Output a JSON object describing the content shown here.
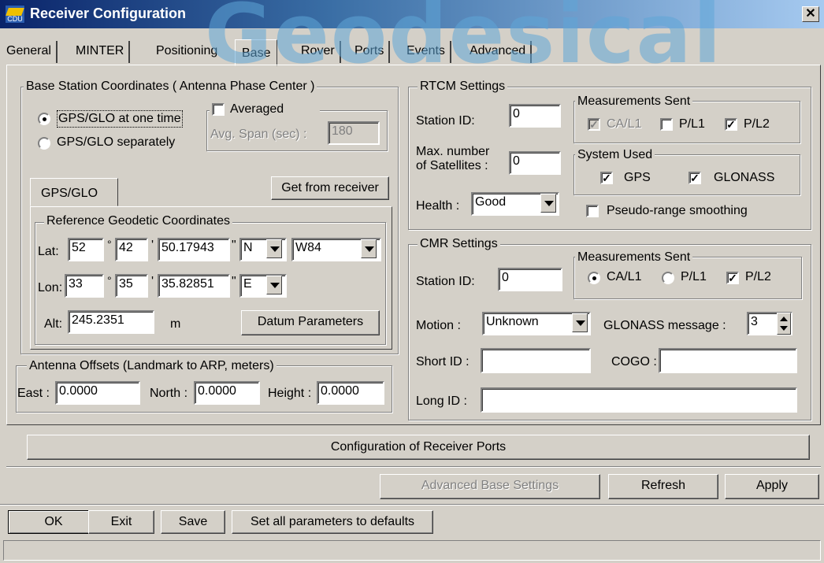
{
  "window": {
    "title": "Receiver Configuration",
    "icon_text": "CDU",
    "close_label": "✕"
  },
  "watermark": "Geodesical",
  "tabs": [
    "General",
    "MINTER",
    "Positioning",
    "Base",
    "Rover",
    "Ports",
    "Events",
    "Advanced"
  ],
  "active_tab": "Base",
  "base_coords": {
    "legend": "Base Station Coordinates ( Antenna Phase Center )",
    "radio_one_time": "GPS/GLO at one time",
    "radio_separately": "GPS/GLO separately",
    "averaged_label": "Averaged",
    "avg_span_label": "Avg. Span (sec) :",
    "avg_span_value": "180",
    "subtab": "GPS/GLO",
    "get_from_receiver": "Get from receiver",
    "ref_legend": "Reference Geodetic Coordinates",
    "lat_label": "Lat:",
    "lat_deg": "52",
    "lat_min": "42",
    "lat_sec": "50.17943",
    "lat_hem": "N",
    "datum": "W84",
    "lon_label": "Lon:",
    "lon_deg": "33",
    "lon_min": "35",
    "lon_sec": "35.82851",
    "lon_hem": "E",
    "deg_mark": "°",
    "min_mark": "'",
    "sec_mark": "\"",
    "alt_label": "Alt:",
    "alt_value": "245.2351",
    "alt_unit": "m",
    "datum_parameters": "Datum Parameters"
  },
  "antenna_offsets": {
    "legend": "Antenna Offsets (Landmark to ARP, meters)",
    "east_label": "East :",
    "east_value": "0.0000",
    "north_label": "North :",
    "north_value": "0.0000",
    "height_label": "Height :",
    "height_value": "0.0000"
  },
  "rtcm": {
    "legend": "RTCM Settings",
    "station_id_label": "Station ID:",
    "station_id_value": "0",
    "max_sat_label_1": "Max. number",
    "max_sat_label_2": "of Satellites :",
    "max_sat_value": "0",
    "health_label": "Health :",
    "health_value": "Good",
    "meas_legend": "Measurements Sent",
    "ca_l1": "CA/L1",
    "p_l1": "P/L1",
    "p_l2": "P/L2",
    "sys_legend": "System Used",
    "gps": "GPS",
    "glonass": "GLONASS",
    "pseudo_range": "Pseudo-range smoothing"
  },
  "cmr": {
    "legend": "CMR Settings",
    "meas_legend": "Measurements Sent",
    "station_id_label": "Station ID:",
    "station_id_value": "0",
    "ca_l1": "CA/L1",
    "p_l1": "P/L1",
    "p_l2": "P/L2",
    "motion_label": "Motion :",
    "motion_value": "Unknown",
    "glonass_msg_label": "GLONASS message :",
    "glonass_msg_value": "3",
    "short_id_label": "Short ID :",
    "short_id_value": "",
    "cogo_label": "COGO :",
    "cogo_value": "",
    "long_id_label": "Long ID :",
    "long_id_value": ""
  },
  "config_ports_button": "Configuration of Receiver Ports",
  "advanced_base_settings": "Advanced Base Settings",
  "refresh": "Refresh",
  "apply": "Apply",
  "bottom_buttons": {
    "ok": "OK",
    "exit": "Exit",
    "save": "Save",
    "defaults": "Set all parameters to defaults"
  },
  "check_mark": "✓"
}
